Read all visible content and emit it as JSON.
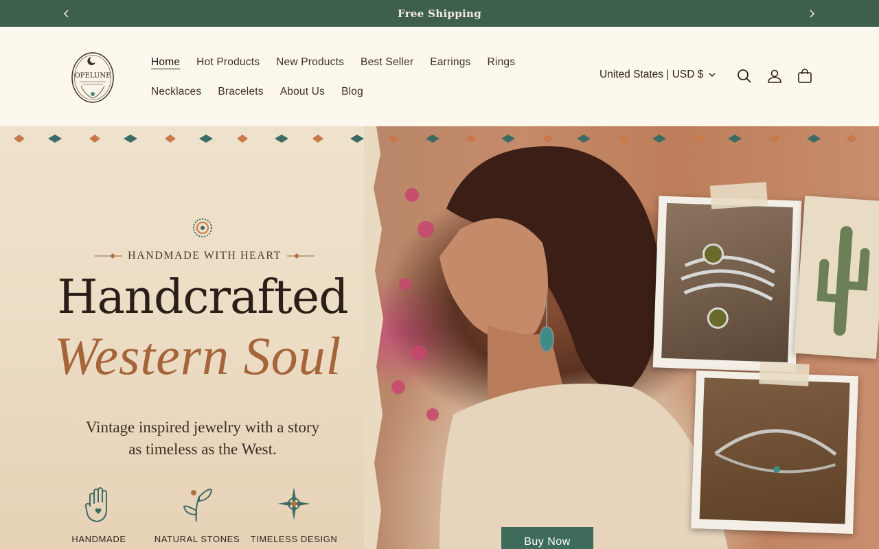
{
  "announcement": {
    "text": "Free Shipping",
    "prev_icon": "chevron-left-icon",
    "next_icon": "chevron-right-icon"
  },
  "header": {
    "logo_text": "OPELUNE",
    "nav_row1": [
      {
        "label": "Home",
        "active": true
      },
      {
        "label": "Hot Products"
      },
      {
        "label": "New Products"
      },
      {
        "label": "Best Seller"
      },
      {
        "label": "Earrings"
      },
      {
        "label": "Rings"
      }
    ],
    "nav_row2": [
      {
        "label": "Necklaces"
      },
      {
        "label": "Bracelets"
      },
      {
        "label": "About Us"
      },
      {
        "label": "Blog"
      }
    ],
    "locale": "United States | USD $",
    "icons": [
      "search-icon",
      "account-icon",
      "cart-icon"
    ]
  },
  "hero": {
    "eyebrow": "HANDMADE WITH HEART",
    "headline": "Handcrafted",
    "script_line": "Western Soul",
    "subline1": "Vintage inspired jewelry with a story",
    "subline2": "as timeless as the West.",
    "features": [
      {
        "label": "HANDMADE",
        "icon": "hand-heart-icon"
      },
      {
        "label": "NATURAL STONES",
        "icon": "sprout-icon"
      },
      {
        "label": "TIMELESS DESIGN",
        "icon": "sun-compass-icon"
      }
    ],
    "cta": "Buy Now"
  },
  "colors": {
    "announcement_bg": "#3f5f4d",
    "accent_green": "#3f6c5a",
    "script_brown": "#a5643a",
    "header_bg": "#fdf8ee"
  }
}
